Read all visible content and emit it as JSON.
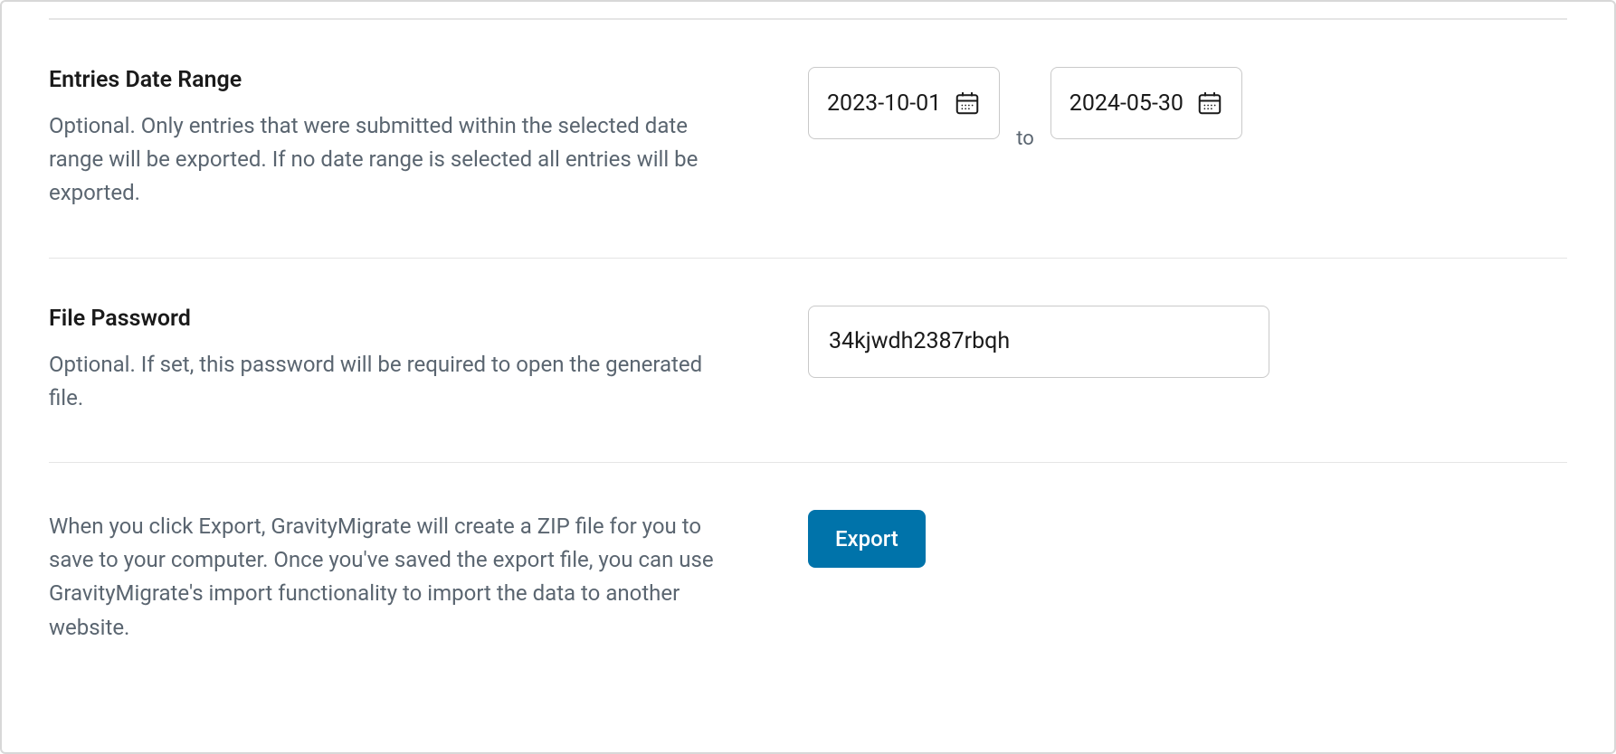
{
  "dateRange": {
    "title": "Entries Date Range",
    "description": "Optional. Only entries that were submitted within the selected date range will be exported. If no date range is selected all entries will be exported.",
    "from": "2023-10-01",
    "separator": "to",
    "to": "2024-05-30"
  },
  "filePassword": {
    "title": "File Password",
    "description": "Optional. If set, this password will be required to open the generated file.",
    "value": "34kjwdh2387rbqh"
  },
  "export": {
    "description": "When you click Export, GravityMigrate will create a ZIP file for you to save to your computer. Once you've saved the export file, you can use GravityMigrate's import functionality to import the data to another website.",
    "buttonLabel": "Export"
  }
}
